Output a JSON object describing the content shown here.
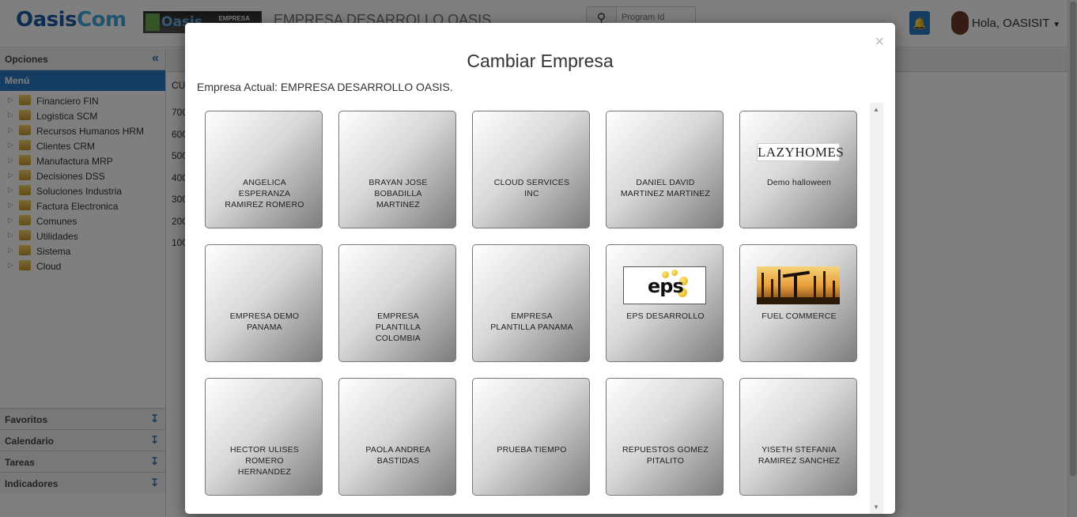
{
  "topbar": {
    "logo_main_a": "Oasis",
    "logo_main_b": "Com",
    "logo_secondary": "Oasis",
    "logo_secondary_tag": "EMPRESA",
    "company_title": "EMPRESA DESARROLLO OASIS",
    "search_placeholder": "Program Id",
    "user_greeting": "Hola, OASISIT"
  },
  "sidebar": {
    "options_label": "Opciones",
    "menu_label": "Menú",
    "items": [
      {
        "label": "Financiero FIN"
      },
      {
        "label": "Logistica SCM"
      },
      {
        "label": "Recursos Humanos HRM"
      },
      {
        "label": "Clientes CRM"
      },
      {
        "label": "Manufactura MRP"
      },
      {
        "label": "Decisiones DSS"
      },
      {
        "label": "Soluciones Industria"
      },
      {
        "label": "Factura Electronica"
      },
      {
        "label": "Comunes"
      },
      {
        "label": "Utilidades"
      },
      {
        "label": "Sistema"
      },
      {
        "label": "Cloud"
      }
    ],
    "footer": [
      {
        "label": "Favoritos"
      },
      {
        "label": "Calendario"
      },
      {
        "label": "Tareas"
      },
      {
        "label": "Indicadores"
      }
    ]
  },
  "content": {
    "partial_label": "CU",
    "ticks": [
      "700",
      "600",
      "500",
      "400",
      "300",
      "200",
      "100"
    ]
  },
  "modal": {
    "title": "Cambiar Empresa",
    "close_symbol": "×",
    "current_company": "Empresa Actual: EMPRESA DESARROLLO OASIS.",
    "companies": [
      {
        "line1": "ANGELICA",
        "line2": "ESPERANZA",
        "line3": "RAMIREZ ROMERO",
        "logo": "none"
      },
      {
        "line1": "BRAYAN JOSE",
        "line2": "BOBADILLA",
        "line3": "MARTINEZ",
        "logo": "none"
      },
      {
        "line1": "CLOUD SERVICES",
        "line2": "INC",
        "line3": "",
        "logo": "none"
      },
      {
        "line1": "DANIEL DAVID",
        "line2": "MARTINEZ MARTINEZ",
        "line3": "",
        "logo": "none"
      },
      {
        "line1": "Demo halloween",
        "line2": "",
        "line3": "",
        "logo": "lazyhomes",
        "logo_text": "LAZYHOMES"
      },
      {
        "line1": "EMPRESA DEMO",
        "line2": "PANAMA",
        "line3": "",
        "logo": "none"
      },
      {
        "line1": "EMPRESA",
        "line2": "PLANTILLA",
        "line3": "COLOMBIA",
        "logo": "none"
      },
      {
        "line1": "EMPRESA",
        "line2": "PLANTILLA PANAMA",
        "line3": "",
        "logo": "none"
      },
      {
        "line1": "EPS DESARROLLO",
        "line2": "",
        "line3": "",
        "logo": "eps",
        "logo_text": "eps"
      },
      {
        "line1": "FUEL COMMERCE",
        "line2": "",
        "line3": "",
        "logo": "oil-rigs"
      },
      {
        "line1": "HECTOR ULISES",
        "line2": "ROMERO",
        "line3": "HERNANDEZ",
        "logo": "none"
      },
      {
        "line1": "PAOLA ANDREA",
        "line2": "BASTIDAS",
        "line3": "",
        "logo": "none"
      },
      {
        "line1": "PRUEBA TIEMPO",
        "line2": "",
        "line3": "",
        "logo": "none"
      },
      {
        "line1": "REPUESTOS GOMEZ",
        "line2": "PITALITO",
        "line3": "",
        "logo": "none"
      },
      {
        "line1": "YISETH STEFANIA",
        "line2": "RAMIREZ SANCHEZ",
        "line3": "",
        "logo": "none"
      }
    ]
  },
  "icons": {
    "search": "search-icon",
    "bell": "bell-icon",
    "close": "close-icon",
    "collapse": "double-chevron-left-icon",
    "expand": "double-chevron-down-icon",
    "folder": "folder-icon"
  },
  "colors": {
    "brand_blue": "#2b7bc2",
    "logo_blue": "#1c5aa6",
    "overlay": "rgba(0,0,0,0.5)"
  }
}
